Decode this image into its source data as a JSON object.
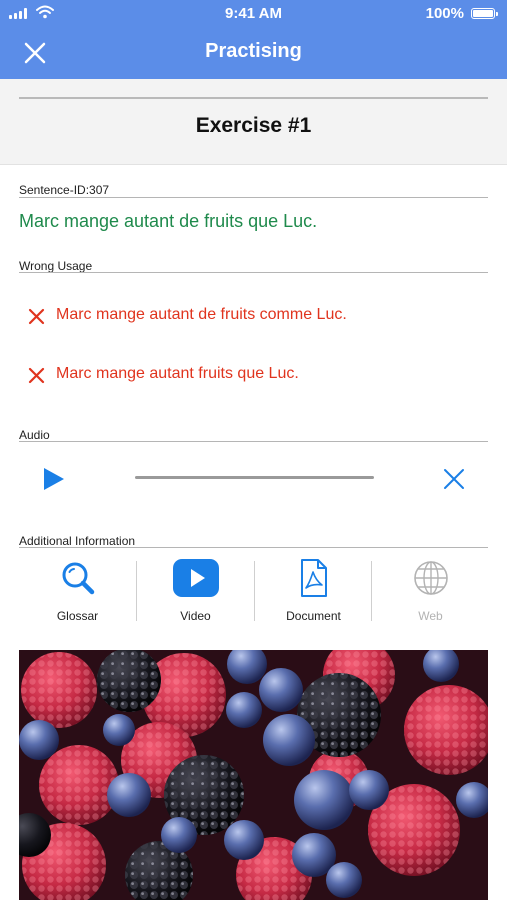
{
  "status_bar": {
    "time": "9:41 AM",
    "battery": "100%"
  },
  "nav": {
    "title": "Practising"
  },
  "exercise": {
    "title": "Exercise #1"
  },
  "sentence": {
    "label": "Sentence-ID:307",
    "text": "Marc mange autant de fruits que Luc."
  },
  "wrong_usage": {
    "label": "Wrong Usage",
    "items": [
      {
        "text": "Marc mange autant de fruits comme Luc."
      },
      {
        "text": "Marc mange autant fruits que Luc."
      }
    ]
  },
  "audio": {
    "label": "Audio",
    "progress": 0
  },
  "additional_info": {
    "label": "Additional Information",
    "items": [
      {
        "label": "Glossar",
        "icon": "search-icon",
        "enabled": true
      },
      {
        "label": "Video",
        "icon": "video-play-icon",
        "enabled": true
      },
      {
        "label": "Document",
        "icon": "pdf-document-icon",
        "enabled": true
      },
      {
        "label": "Web",
        "icon": "globe-icon",
        "enabled": false
      }
    ]
  },
  "colors": {
    "primary": "#5b8de8",
    "accent": "#1a7fe6",
    "correct": "#1f8a4c",
    "wrong": "#e0341e",
    "disabled": "#b3b3b3"
  }
}
